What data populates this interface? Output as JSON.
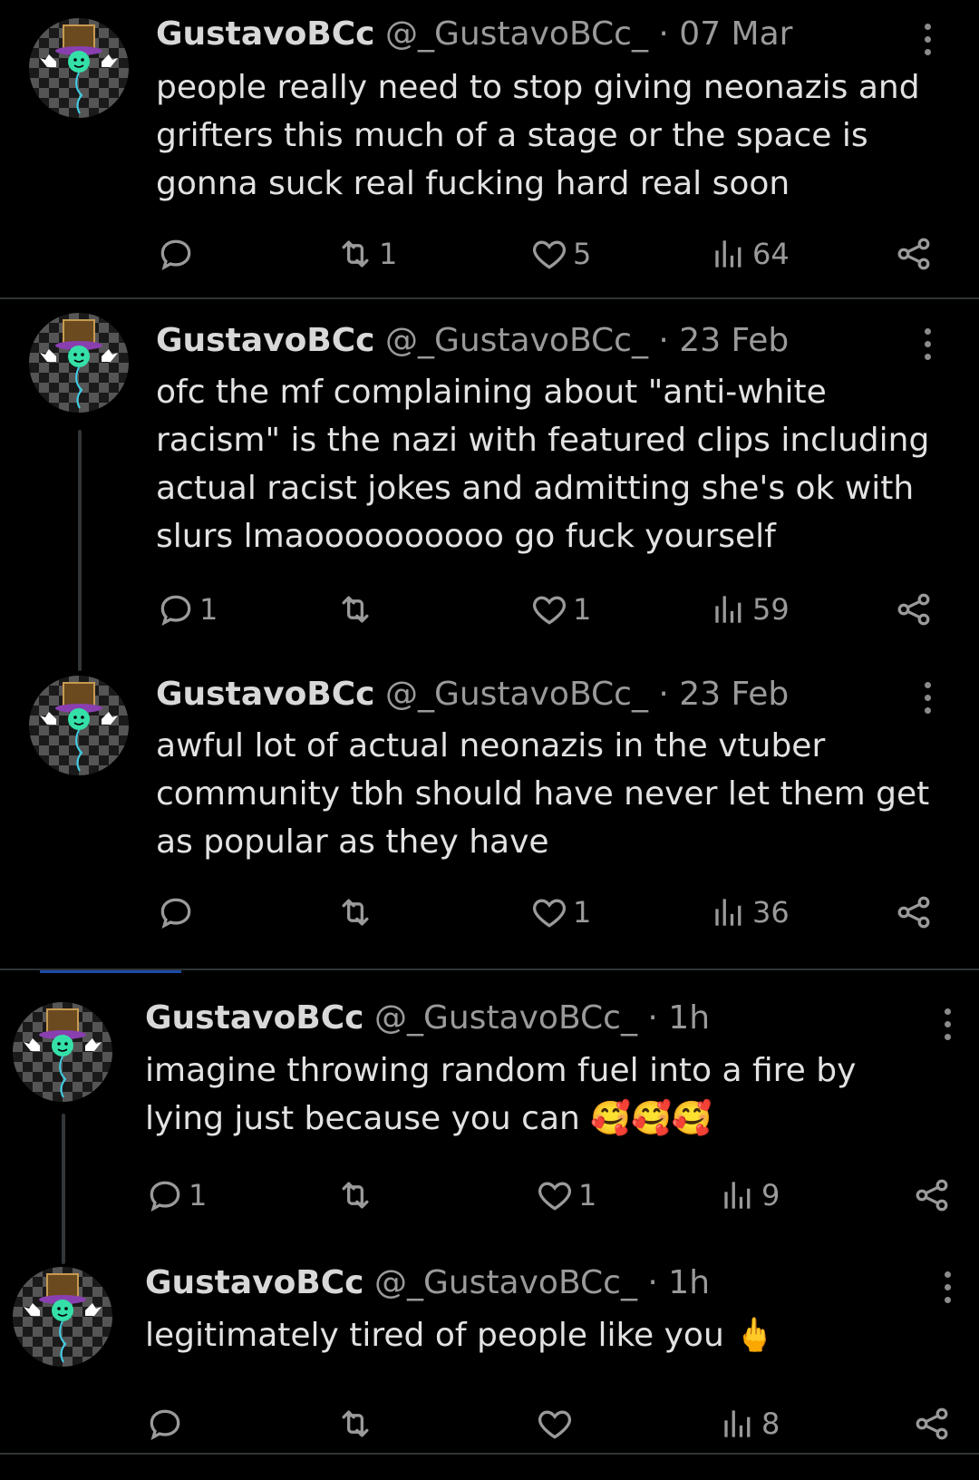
{
  "tweets": [
    {
      "name": "GustavoBCc",
      "handle": "@_GustavoBCc_",
      "sep": "·",
      "time": "07 Mar",
      "text": "people really need to stop giving neonazis and\ngrifters this much of a stage or the space is\ngonna suck real fucking hard real soon",
      "replies": "",
      "retweets": "1",
      "likes": "5",
      "views": "64"
    },
    {
      "name": "GustavoBCc",
      "handle": "@_GustavoBCc_",
      "sep": "·",
      "time": "23 Feb",
      "text": "ofc the mf complaining about \"anti-white\nracism\" is the nazi with featured clips including\nactual racist jokes and admitting she's ok with\nslurs lmaoooooooooo go fuck yourself",
      "replies": "1",
      "retweets": "",
      "likes": "1",
      "views": "59"
    },
    {
      "name": "GustavoBCc",
      "handle": "@_GustavoBCc_",
      "sep": "·",
      "time": "23 Feb",
      "text": "awful lot of actual neonazis in the vtuber\ncommunity tbh should have never let them get\nas popular as they have",
      "replies": "",
      "retweets": "",
      "likes": "1",
      "views": "36"
    },
    {
      "name": "GustavoBCc",
      "handle": "@_GustavoBCc_",
      "sep": "·",
      "time": "1h",
      "text": "imagine throwing random fuel into a fire by\nlying just because you can 🥰🥰🥰",
      "replies": "1",
      "retweets": "",
      "likes": "1",
      "views": "9"
    },
    {
      "name": "GustavoBCc",
      "handle": "@_GustavoBCc_",
      "sep": "·",
      "time": "1h",
      "text": "legitimately tired of people like you 🖕",
      "replies": "",
      "retweets": "",
      "likes": "",
      "views": "8"
    }
  ],
  "icons": {
    "reply": "reply-icon",
    "retweet": "retweet-icon",
    "like": "heart-icon",
    "views": "views-icon",
    "share": "share-icon",
    "more": "more-icon"
  },
  "colors": {
    "background": "#000000",
    "text": "#e7e9ea",
    "secondary": "#9a9a9a",
    "divider": "#2f3336",
    "accent": "#1d4aa8"
  }
}
